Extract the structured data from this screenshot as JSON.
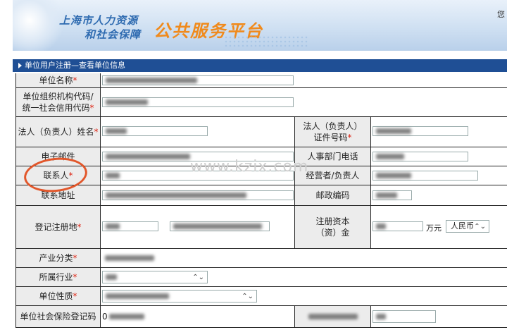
{
  "header": {
    "line1": "上海市人力资源",
    "line2": "和社会保障",
    "platform": "公共服务平台",
    "corner_text": "您"
  },
  "section_title": "单位用户注册—查看单位信息",
  "form": {
    "company_name_label": "单位名称",
    "org_code_label_l1": "单位组织机构代码/",
    "org_code_label_l2": "统一社会信用代码",
    "legal_person_label": "法人（负责人）姓名",
    "legal_id_label_l1": "法人（负责人）",
    "legal_id_label_l2": "证件号码",
    "email_label": "电子邮件",
    "hr_phone_label": "人事部门电话",
    "contact_label": "联系人",
    "operator_label": "经营者/负责人",
    "address_label": "联系地址",
    "postcode_label": "邮政编码",
    "reg_place_label": "登记注册地",
    "reg_capital_label_l1": "注册资本",
    "reg_capital_label_l2": "（资）金",
    "capital_unit": "万元",
    "currency": "人民币",
    "industry_class_label": "产业分类",
    "sector_label": "所属行业",
    "nature_label": "单位性质",
    "ss_reg_label": "单位社会保险登记码",
    "ss_reg_value_prefix": "0"
  },
  "watermark": "www.kzix.com",
  "colors": {
    "section_bar": "#1f4f95",
    "label_bg": "#ececec",
    "required": "#dd1111",
    "annotation": "#e2572b",
    "platform_title": "#f08a1c",
    "banner_title": "#2d6ab0"
  }
}
